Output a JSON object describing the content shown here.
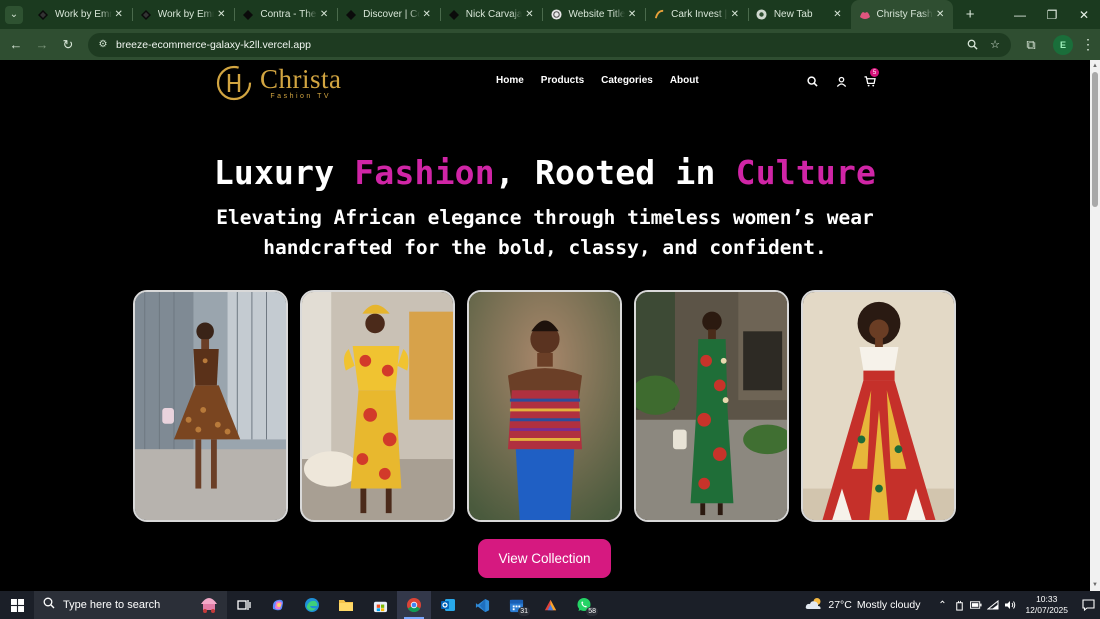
{
  "browser": {
    "tabs": [
      {
        "title": "Work by Emma",
        "icon": "figma-diamond-icon",
        "active": false
      },
      {
        "title": "Work by Emma",
        "icon": "figma-diamond-icon",
        "active": false
      },
      {
        "title": "Contra - The c",
        "icon": "contra-icon",
        "active": false
      },
      {
        "title": "Discover | Con",
        "icon": "contra-icon",
        "active": false
      },
      {
        "title": "Nick Carvajal |",
        "icon": "diamond-icon",
        "active": false
      },
      {
        "title": "Website Title I",
        "icon": "globe-icon",
        "active": false
      },
      {
        "title": "Cark Invest | W",
        "icon": "cark-icon",
        "active": false
      },
      {
        "title": "New Tab",
        "icon": "chrome-icon",
        "active": false
      },
      {
        "title": "Christy Fashion",
        "icon": "christy-icon",
        "active": true
      }
    ],
    "url": "breeze-ecommerce-galaxy-k2ll.vercel.app",
    "profile_initial": "E",
    "accent": "#2f4e31"
  },
  "site": {
    "logo_name": "Christa",
    "logo_sub": "Fashion TV",
    "logo_mark": "H",
    "menu": [
      "Home",
      "Products",
      "Categories",
      "About"
    ],
    "cart_count": "5"
  },
  "hero": {
    "headline_1": "Luxury ",
    "headline_accent_1": "Fashion",
    "headline_2": ", Rooted in ",
    "headline_accent_2": "Culture",
    "subhead_line_1": "Elevating African elegance through timeless women’s wear",
    "subhead_line_2": "handcrafted for the bold, classy, and confident.",
    "cta": "View Collection",
    "accent_color": "#d025a6"
  },
  "gallery": [
    "model-brown-print-dress-photo",
    "model-yellow-red-dress-photo",
    "model-striped-top-photo",
    "model-green-red-dress-photo",
    "model-red-yellow-gown-photo"
  ],
  "taskbar": {
    "search_placeholder": "Type here to search",
    "apps": [
      {
        "name": "task-view",
        "badge": ""
      },
      {
        "name": "copilot",
        "badge": ""
      },
      {
        "name": "edge",
        "badge": ""
      },
      {
        "name": "file-explorer",
        "badge": ""
      },
      {
        "name": "microsoft-store",
        "badge": ""
      },
      {
        "name": "chrome",
        "badge": ""
      },
      {
        "name": "outlook",
        "badge": ""
      },
      {
        "name": "vscode",
        "badge": ""
      },
      {
        "name": "calendar",
        "badge": "31"
      },
      {
        "name": "app",
        "badge": ""
      },
      {
        "name": "whatsapp",
        "badge": "58"
      }
    ],
    "weather_temp": "27°C",
    "weather_desc": "Mostly cloudy",
    "time": "10:33",
    "date": "12/07/2025"
  }
}
